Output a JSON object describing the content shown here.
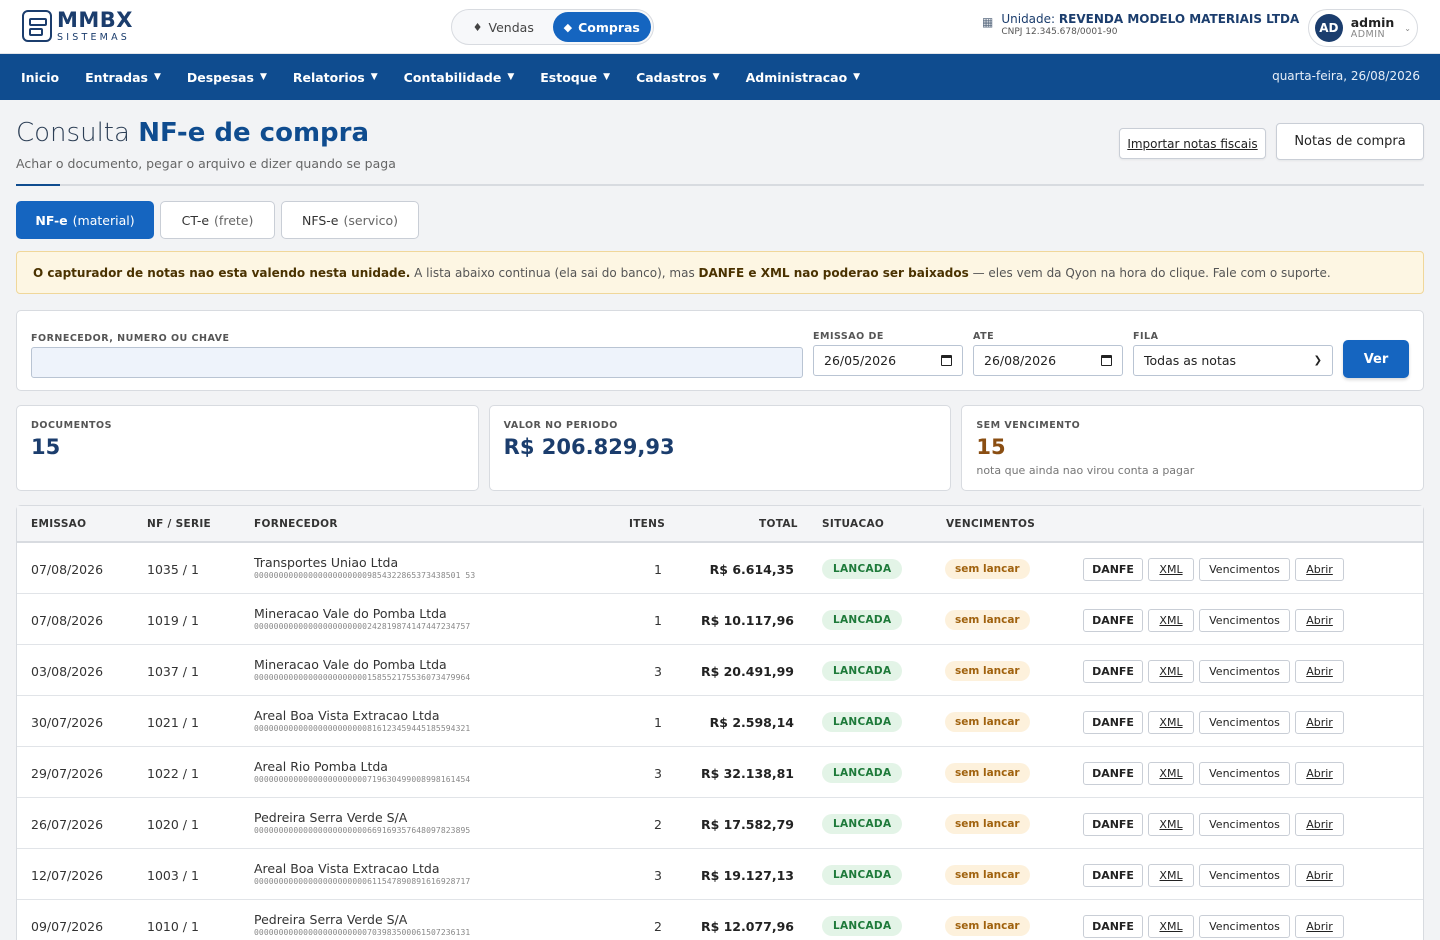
{
  "brand": {
    "name": "MMBX",
    "tagline": "SISTEMAS"
  },
  "mode_switch": [
    {
      "label": "Vendas",
      "icon": "tag-icon",
      "active": false
    },
    {
      "label": "Compras",
      "icon": "box-icon",
      "active": true
    }
  ],
  "unit": {
    "prefix": "Unidade:",
    "name": "REVENDA MODELO MATERIAIS LTDA",
    "cnpj": "CNPJ 12.345.678/0001-90"
  },
  "user": {
    "initials": "AD",
    "name": "admin",
    "role": "ADMIN"
  },
  "nav": {
    "items": [
      {
        "label": "Inicio",
        "dropdown": false
      },
      {
        "label": "Entradas",
        "dropdown": true
      },
      {
        "label": "Despesas",
        "dropdown": true
      },
      {
        "label": "Relatorios",
        "dropdown": true
      },
      {
        "label": "Contabilidade",
        "dropdown": true
      },
      {
        "label": "Estoque",
        "dropdown": true
      },
      {
        "label": "Cadastros",
        "dropdown": true
      },
      {
        "label": "Administracao",
        "dropdown": true
      }
    ],
    "date": "quarta-feira, 26/08/2026"
  },
  "page": {
    "title_light": "Consulta",
    "title_bold": "NF-e de compra",
    "subtitle": "Achar o documento, pegar o arquivo e dizer quando se paga",
    "import_button": "Importar notas fiscais",
    "notes_button": "Notas de compra"
  },
  "doc_tabs": [
    {
      "label": "NF-e",
      "sub": "(material)",
      "active": true
    },
    {
      "label": "CT-e",
      "sub": "(frete)",
      "active": false
    },
    {
      "label": "NFS-e",
      "sub": "(servico)",
      "active": false
    }
  ],
  "alert": {
    "bold1": "O capturador de notas nao esta valendo nesta unidade.",
    "text1": " A lista abaixo continua (ela sai do banco), mas ",
    "bold2": "DANFE e XML nao poderao ser baixados",
    "text2": " — eles vem da Qyon na hora do clique. Fale com o suporte."
  },
  "filters": {
    "search_label": "FORNECEDOR, NUMERO OU CHAVE",
    "search_value": "",
    "from_label": "EMISSAO DE",
    "from_value": "26/05/2026",
    "to_label": "ATE",
    "to_value": "26/08/2026",
    "queue_label": "FILA",
    "queue_value": "Todas as notas",
    "submit": "Ver"
  },
  "cards": [
    {
      "label": "DOCUMENTOS",
      "value": "15",
      "note": ""
    },
    {
      "label": "VALOR NO PERIODO",
      "value": "R$ 206.829,93",
      "note": ""
    },
    {
      "label": "SEM VENCIMENTO",
      "value": "15",
      "note": "nota que ainda nao virou conta a pagar"
    }
  ],
  "table": {
    "headers": {
      "emissao": "EMISSAO",
      "nf": "NF / SERIE",
      "fornecedor": "FORNECEDOR",
      "itens": "ITENS",
      "total": "TOTAL",
      "situacao": "SITUACAO",
      "vencimentos": "VENCIMENTOS"
    },
    "actions": {
      "danfe": "DANFE",
      "xml": "XML",
      "venc": "Vencimentos",
      "abrir": "Abrir"
    },
    "rows": [
      {
        "date": "07/08/2026",
        "nf": "1035 / 1",
        "supplier": "Transportes Uniao Ltda",
        "key": "000000000000000000000009854322865373438501 53",
        "items": "1",
        "total": "R$ 6.614,35",
        "status": "LANCADA",
        "due": "sem lancar"
      },
      {
        "date": "07/08/2026",
        "nf": "1019 / 1",
        "supplier": "Mineracao Vale do Pomba Ltda",
        "key": "00000000000000000000000242819874147447234757",
        "items": "1",
        "total": "R$ 10.117,96",
        "status": "LANCADA",
        "due": "sem lancar"
      },
      {
        "date": "03/08/2026",
        "nf": "1037 / 1",
        "supplier": "Mineracao Vale do Pomba Ltda",
        "key": "00000000000000000000000158552175536073479964",
        "items": "3",
        "total": "R$ 20.491,99",
        "status": "LANCADA",
        "due": "sem lancar"
      },
      {
        "date": "30/07/2026",
        "nf": "1021 / 1",
        "supplier": "Areal Boa Vista Extracao Ltda",
        "key": "00000000000000000000000816123459445185594321",
        "items": "1",
        "total": "R$ 2.598,14",
        "status": "LANCADA",
        "due": "sem lancar"
      },
      {
        "date": "29/07/2026",
        "nf": "1022 / 1",
        "supplier": "Areal Rio Pomba Ltda",
        "key": "00000000000000000000000719630499008998161454",
        "items": "3",
        "total": "R$ 32.138,81",
        "status": "LANCADA",
        "due": "sem lancar"
      },
      {
        "date": "26/07/2026",
        "nf": "1020 / 1",
        "supplier": "Pedreira Serra Verde S/A",
        "key": "00000000000000000000000669169357648097823895",
        "items": "2",
        "total": "R$ 17.582,79",
        "status": "LANCADA",
        "due": "sem lancar"
      },
      {
        "date": "12/07/2026",
        "nf": "1003 / 1",
        "supplier": "Areal Boa Vista Extracao Ltda",
        "key": "00000000000000000000000611547890891616928717",
        "items": "3",
        "total": "R$ 19.127,13",
        "status": "LANCADA",
        "due": "sem lancar"
      },
      {
        "date": "09/07/2026",
        "nf": "1010 / 1",
        "supplier": "Pedreira Serra Verde S/A",
        "key": "00000000000000000000000703983500061507236131",
        "items": "2",
        "total": "R$ 12.077,96",
        "status": "LANCADA",
        "due": "sem lancar"
      }
    ]
  },
  "colors": {
    "primary": "#1565c0",
    "nav": "#0f4c8f",
    "brand": "#1b3d6d",
    "ok": "#1e7a3a",
    "pending": "#a0620e"
  }
}
